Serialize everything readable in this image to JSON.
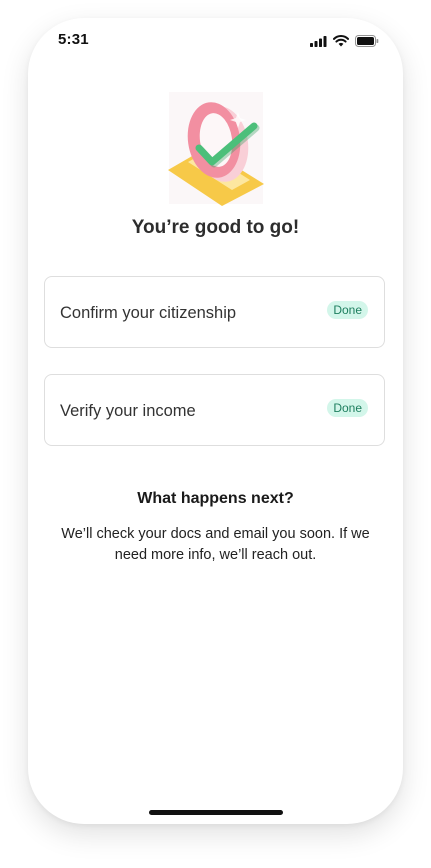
{
  "status_bar": {
    "time": "5:31",
    "icons": [
      "signal-icon",
      "wifi-icon",
      "battery-icon"
    ]
  },
  "hero": {
    "icon": "success-check-illustration",
    "colors": {
      "ring": "#f28fa1",
      "check": "#4cbf7a",
      "ribbon": "#f7c948"
    }
  },
  "title": "You’re good to go!",
  "tasks": [
    {
      "label": "Confirm your citizenship",
      "status": "Done"
    },
    {
      "label": "Verify your income",
      "status": "Done"
    }
  ],
  "next": {
    "title": "What happens next?",
    "body": "We’ll check your docs and email you soon. If we need more info, we’ll reach out."
  },
  "theme": {
    "badge_bg": "#d3f6ea",
    "badge_text": "#1e7f5f",
    "card_border": "#dedede"
  }
}
